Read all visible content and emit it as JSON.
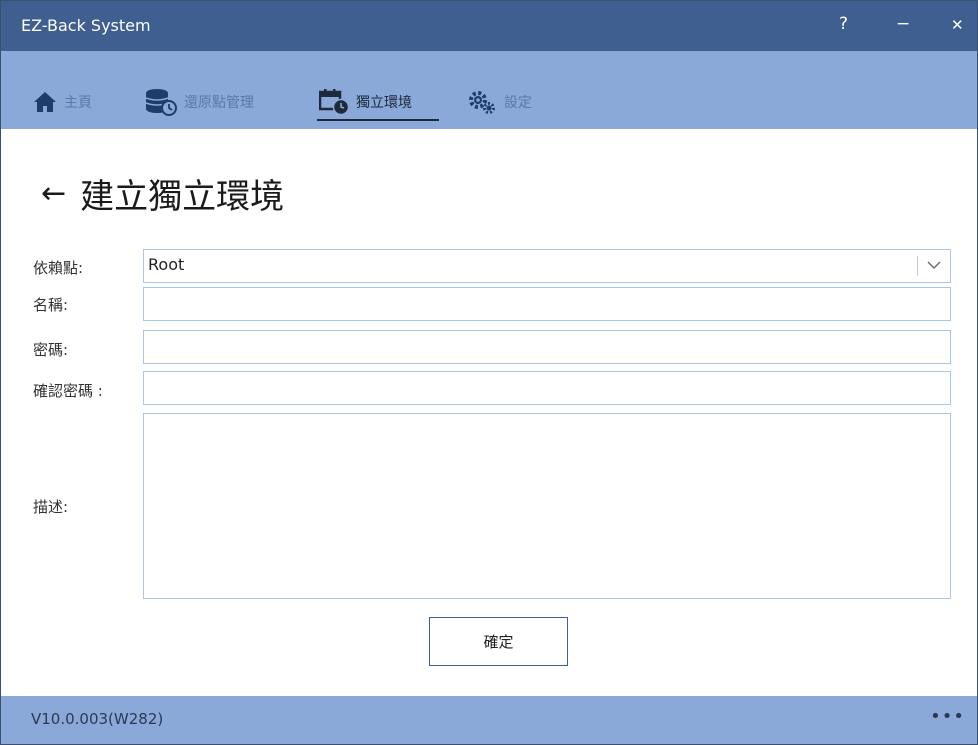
{
  "window": {
    "title": "EZ-Back System",
    "help_label": "?",
    "minimize_label": "−",
    "close_label": "✕"
  },
  "nav": {
    "items": [
      {
        "label": "主頁",
        "icon": "home-icon"
      },
      {
        "label": "還原點管理",
        "icon": "database-restore-icon"
      },
      {
        "label": "獨立環境",
        "icon": "calendar-clock-icon",
        "active": true
      },
      {
        "label": "設定",
        "icon": "gears-icon"
      }
    ]
  },
  "page": {
    "back_glyph": "←",
    "title": "建立獨立環境"
  },
  "form": {
    "depend_label": "依賴點:",
    "depend_value": "Root",
    "name_label": "名稱:",
    "name_value": "",
    "password_label": "密碼:",
    "password_value": "",
    "confirm_label": "確認密碼 :",
    "confirm_value": "",
    "desc_label": "描述:",
    "desc_value": "",
    "submit_label": "確定"
  },
  "footer": {
    "version": "V10.0.003(W282)",
    "more_label": "•••"
  },
  "colors": {
    "titlebar": "#3e5f8f",
    "navbar": "#8aa8d8",
    "field_border": "#a9c6e3",
    "active_text": "#1c2a3c",
    "muted_text": "#5a78aa"
  }
}
